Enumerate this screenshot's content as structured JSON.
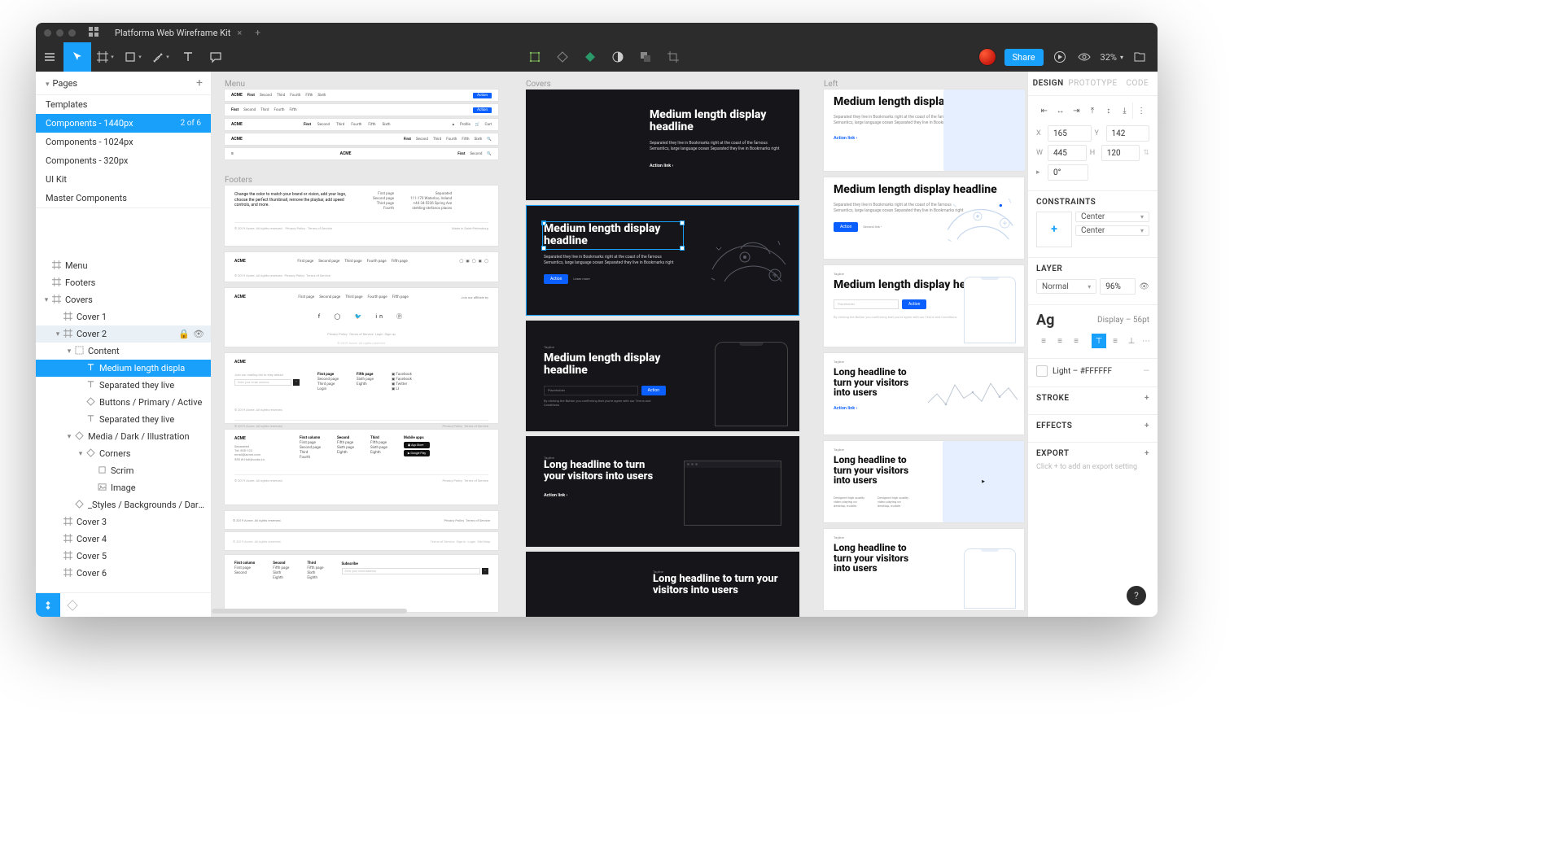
{
  "window": {
    "tab_title": "Platforma Web Wireframe Kit"
  },
  "toolbar": {
    "share_label": "Share",
    "zoom": "32%"
  },
  "pages_panel": {
    "header": "Pages",
    "items": [
      {
        "label": "Templates"
      },
      {
        "label": "Components - 1440px",
        "count": "2 of 6",
        "selected": true
      },
      {
        "label": "Components - 1024px"
      },
      {
        "label": "Components - 320px"
      },
      {
        "label": "UI Kit"
      },
      {
        "label": "Master Components"
      }
    ]
  },
  "layers": [
    {
      "depth": 0,
      "icon": "frame",
      "label": "Menu"
    },
    {
      "depth": 0,
      "icon": "frame",
      "label": "Footers"
    },
    {
      "depth": 0,
      "icon": "frame",
      "label": "Covers",
      "open": true
    },
    {
      "depth": 1,
      "icon": "frame",
      "label": "Cover 1"
    },
    {
      "depth": 1,
      "icon": "frame",
      "label": "Cover 2",
      "open": true,
      "light": true,
      "lock": true,
      "eye": true
    },
    {
      "depth": 2,
      "icon": "group",
      "label": "Content",
      "open": true
    },
    {
      "depth": 3,
      "icon": "text",
      "label": "Medium length displa",
      "selected": true
    },
    {
      "depth": 3,
      "icon": "text",
      "label": "Separated they live"
    },
    {
      "depth": 3,
      "icon": "component",
      "label": "Buttons / Primary / Active"
    },
    {
      "depth": 3,
      "icon": "text",
      "label": "Separated they live"
    },
    {
      "depth": 2,
      "icon": "component",
      "label": "Media / Dark / Illustration",
      "open": true
    },
    {
      "depth": 3,
      "icon": "component",
      "label": "Corners",
      "open": true
    },
    {
      "depth": 4,
      "icon": "rect",
      "label": "Scrim"
    },
    {
      "depth": 4,
      "icon": "image",
      "label": "Image"
    },
    {
      "depth": 2,
      "icon": "component",
      "label": "_Styles / Backgrounds / Dark I..."
    },
    {
      "depth": 1,
      "icon": "frame",
      "label": "Cover 3"
    },
    {
      "depth": 1,
      "icon": "frame",
      "label": "Cover 4"
    },
    {
      "depth": 1,
      "icon": "frame",
      "label": "Cover 5"
    },
    {
      "depth": 1,
      "icon": "frame",
      "label": "Cover 6"
    }
  ],
  "canvas": {
    "section_labels": {
      "menu": "Menu",
      "footers": "Footers",
      "covers": "Covers",
      "left": "Left"
    },
    "acme": "ACME",
    "nav_items": [
      "First",
      "Second",
      "Third",
      "Fourth",
      "Fifth",
      "Sixth"
    ],
    "action": "Action",
    "profile": "Profile",
    "cart": "Cart",
    "footer_blurb": "Change the color to match your brand or vision, add your logo, choose the perfect thumbnail, remove the playbar, add speed controls, and more.",
    "footer_cols": {
      "a": [
        "First page",
        "Second page",
        "Third page",
        "Fourth"
      ],
      "b": [
        "Separated",
        "111-170 Waterloo, Ireland",
        "+44 34-5236 Spring Ave",
        "stehling-stefanos places"
      ]
    },
    "footer_legal": "© 2019 Acme. All rights reserved.",
    "footer_links": [
      "Privacy Policy",
      "Terms of Service"
    ],
    "madein": "Made in Saint-Petersburg",
    "cols5": [
      "First page",
      "Second page",
      "Third page",
      "Fourth page",
      "Fifth page"
    ],
    "email_placeholder": "Enter your email address",
    "socials_note": "Join our affiliate by",
    "first_column": "First column",
    "second": "Second",
    "third": "Third",
    "mobile_apps": "Mobile apps",
    "subscribe": "Subscribe",
    "subscribe_ph": "Enter your email address",
    "terms_links": [
      "Terms of Service",
      "Sign in",
      "Login",
      "Site Map"
    ],
    "headline_medium": "Medium length display headline",
    "para1": "Separated they live in Bookmarks right at the coast of the famous Semantics, large language ocean Separated they live in Bookmarks right",
    "para2": "Separated they live in Bookmarks right at the coast of the famous Semantics, large language ocean Separated they live in Bookmarks right",
    "action_link": "Action link  ›",
    "action_button": "Action",
    "action_secondary": "Learn more",
    "by_clicking": "By clicking the Button you confirming that you're agree with our Terms and Conditions",
    "tagline": "Tagline",
    "long_headline": "Long headline to turn your visitors into users",
    "desc_small": "Designed high quality video playing on desktop, mobile.",
    "placeholder": "Placeholder"
  },
  "inspector": {
    "tabs": [
      "DESIGN",
      "PROTOTYPE",
      "CODE"
    ],
    "x": "165",
    "y": "142",
    "w": "445",
    "h": "120",
    "r": "0°",
    "constraints": {
      "title": "CONSTRAINTS",
      "h": "Center",
      "v": "Center"
    },
    "layer": {
      "title": "LAYER",
      "blend": "Normal",
      "opacity": "96%"
    },
    "type": {
      "sample": "Ag",
      "desc": "Display – 56pt"
    },
    "fill": {
      "label": "Light – #FFFFFF"
    },
    "stroke": {
      "title": "STROKE"
    },
    "effects": {
      "title": "EFFECTS"
    },
    "export": {
      "title": "EXPORT",
      "hint": "Click + to add an export setting"
    }
  }
}
